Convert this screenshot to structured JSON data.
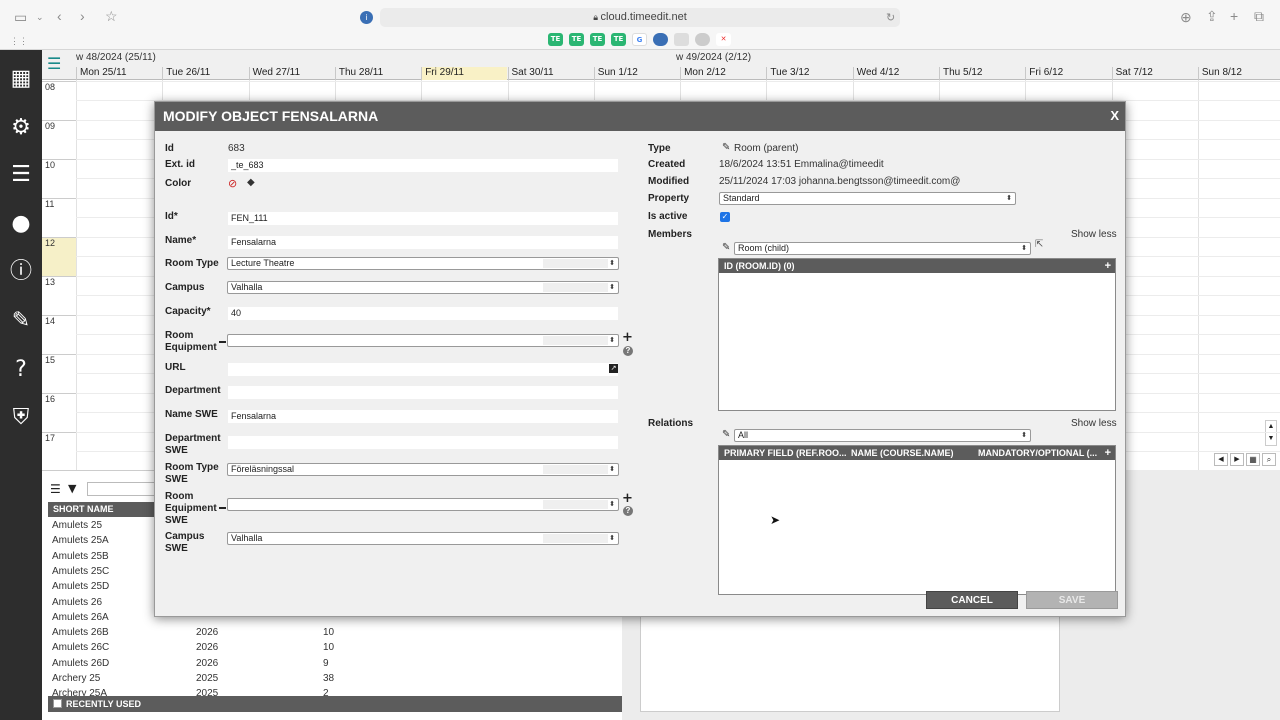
{
  "browser": {
    "url": "cloud.timeedit.net",
    "tab_icons": [
      "TE",
      "TE",
      "TE",
      "TE",
      "G"
    ]
  },
  "calendar": {
    "week1": "w 48/2024 (25/11)",
    "week2": "w 49/2024 (2/12)",
    "days": [
      "Mon 25/11",
      "Tue 26/11",
      "Wed 27/11",
      "Thu 28/11",
      "Fri 29/11",
      "Sat 30/11",
      "Sun 1/12",
      "Mon 2/12",
      "Tue 3/12",
      "Wed 4/12",
      "Thu 5/12",
      "Fri 6/12",
      "Sat 7/12",
      "Sun 8/12"
    ],
    "hours": [
      "08",
      "09",
      "10",
      "11",
      "12",
      "13",
      "14",
      "15",
      "16",
      "17"
    ]
  },
  "list": {
    "header": "SHORT NAME (STUDENT",
    "rows": [
      [
        "Amulets 25",
        "",
        ""
      ],
      [
        "Amulets 25A",
        "",
        ""
      ],
      [
        "Amulets 25B",
        "",
        ""
      ],
      [
        "Amulets 25C",
        "",
        ""
      ],
      [
        "Amulets 25D",
        "",
        ""
      ],
      [
        "Amulets 26",
        "",
        ""
      ],
      [
        "Amulets 26A",
        "",
        ""
      ],
      [
        "Amulets 26B",
        "2026",
        "10"
      ],
      [
        "Amulets 26C",
        "2026",
        "10"
      ],
      [
        "Amulets 26D",
        "2026",
        "9"
      ],
      [
        "Archery 25",
        "2025",
        "38"
      ],
      [
        "Archery 25A",
        "2025",
        "2"
      ]
    ],
    "recently_used": "RECENTLY USED"
  },
  "modal": {
    "title": "MODIFY OBJECT FENSALARNA",
    "close": "X",
    "labels": {
      "id": "Id",
      "ext_id": "Ext. id",
      "color": "Color",
      "id_req": "Id*",
      "name": "Name*",
      "room_type": "Room Type",
      "campus": "Campus",
      "capacity": "Capacity*",
      "room_equipment_1": "Room",
      "room_equipment_2": "Equipment",
      "url": "URL",
      "department": "Department",
      "name_swe": "Name SWE",
      "dept_swe_1": "Department",
      "dept_swe_2": "SWE",
      "room_type_swe_1": "Room Type",
      "room_type_swe_2": "SWE",
      "room_eq_swe_1": "Room",
      "room_eq_swe_2": "Equipment",
      "room_eq_swe_3": "SWE",
      "campus_swe_1": "Campus",
      "campus_swe_2": "SWE",
      "type": "Type",
      "created": "Created",
      "modified": "Modified",
      "property": "Property",
      "is_active": "Is active",
      "members": "Members",
      "relations": "Relations"
    },
    "values": {
      "id": "683",
      "ext_id": "_te_683",
      "id_req": "FEN_111",
      "name": "Fensalarna",
      "room_type": "Lecture Theatre",
      "campus": "Valhalla",
      "capacity": "40",
      "room_equipment": "",
      "url": "",
      "department": "",
      "name_swe": "Fensalarna",
      "department_swe": "",
      "room_type_swe": "Föreläsningssal",
      "room_equipment_swe": "",
      "campus_swe": "Valhalla",
      "type": "Room (parent)",
      "created": "18/6/2024 13:51 Emmalina@timeedit",
      "modified": "25/11/2024 17:03 johanna.bengtsson@timeedit.com@",
      "property": "Standard",
      "members_select": "Room (child)",
      "relations_select": "All"
    },
    "show_less": "Show less",
    "members_grid_header": "ID (ROOM.ID) (0)",
    "relations_grid_headers": [
      "PRIMARY FIELD (REF.ROO...",
      "NAME (COURSE.NAME)",
      "MANDATORY/OPTIONAL (..."
    ],
    "cancel": "CANCEL",
    "save": "SAVE"
  },
  "colors": {
    "accent": "#5c5c5c",
    "sidebar": "#2d2d2d",
    "checkbox": "#1e74e6",
    "today": "#f9f1c6"
  }
}
